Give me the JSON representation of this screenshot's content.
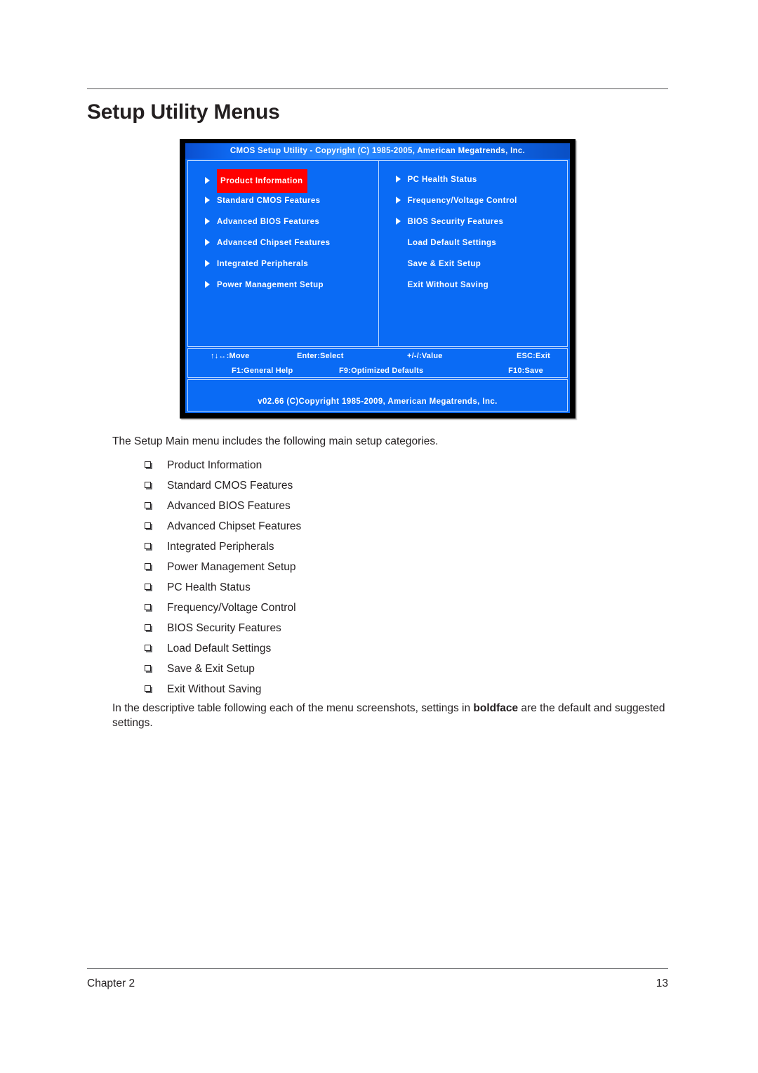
{
  "document": {
    "page_title": "Setup Utility Menus",
    "footer": {
      "chapter": "Chapter 2",
      "page_number": "13"
    }
  },
  "bios_screen": {
    "titlebar": "CMOS Setup Utility - Copyright (C) 1985-2005, American Megatrends, Inc.",
    "left_column": [
      {
        "label": "Product Information",
        "arrow": true,
        "selected": true
      },
      {
        "label": "Standard CMOS Features",
        "arrow": true,
        "selected": false
      },
      {
        "label": "Advanced BIOS Features",
        "arrow": true,
        "selected": false
      },
      {
        "label": "Advanced Chipset Features",
        "arrow": true,
        "selected": false
      },
      {
        "label": "Integrated Peripherals",
        "arrow": true,
        "selected": false
      },
      {
        "label": "Power Management Setup",
        "arrow": true,
        "selected": false
      }
    ],
    "right_column": [
      {
        "label": "PC Health Status",
        "arrow": true,
        "selected": false
      },
      {
        "label": "Frequency/Voltage Control",
        "arrow": true,
        "selected": false
      },
      {
        "label": "BIOS Security Features",
        "arrow": true,
        "selected": false
      },
      {
        "label": "Load Default Settings",
        "arrow": false,
        "selected": false
      },
      {
        "label": "Save & Exit Setup",
        "arrow": false,
        "selected": false
      },
      {
        "label": "Exit Without Saving",
        "arrow": false,
        "selected": false
      }
    ],
    "hints": {
      "move": "↑↓↔:Move",
      "enter": "Enter:Select",
      "value": "+/-/:Value",
      "esc": "ESC:Exit",
      "f1": "F1:General Help",
      "f9": "F9:Optimized Defaults",
      "f10": "F10:Save"
    },
    "version": "v02.66  (C)Copyright  1985-2009,  American  Megatrends,  Inc.",
    "colors": {
      "background_blue": "#0a6bf5",
      "selection_red": "#ff0000",
      "border_light": "#bcd9ff",
      "text_white": "#ffffff",
      "outer_border": "#000000"
    }
  },
  "body": {
    "intro": "The Setup Main menu includes the following main setup categories.",
    "categories": [
      "Product Information",
      "Standard CMOS Features",
      "Advanced BIOS Features",
      "Advanced Chipset Features",
      "Integrated Peripherals",
      "Power Management Setup",
      "PC Health Status",
      "Frequency/Voltage Control",
      "BIOS Security Features",
      "Load Default Settings",
      "Save & Exit Setup",
      "Exit Without Saving"
    ],
    "outro_part1": "In the descriptive table following each of the menu screenshots, settings in ",
    "outro_bold": "boldface",
    "outro_part2": " are the default and suggested settings."
  }
}
